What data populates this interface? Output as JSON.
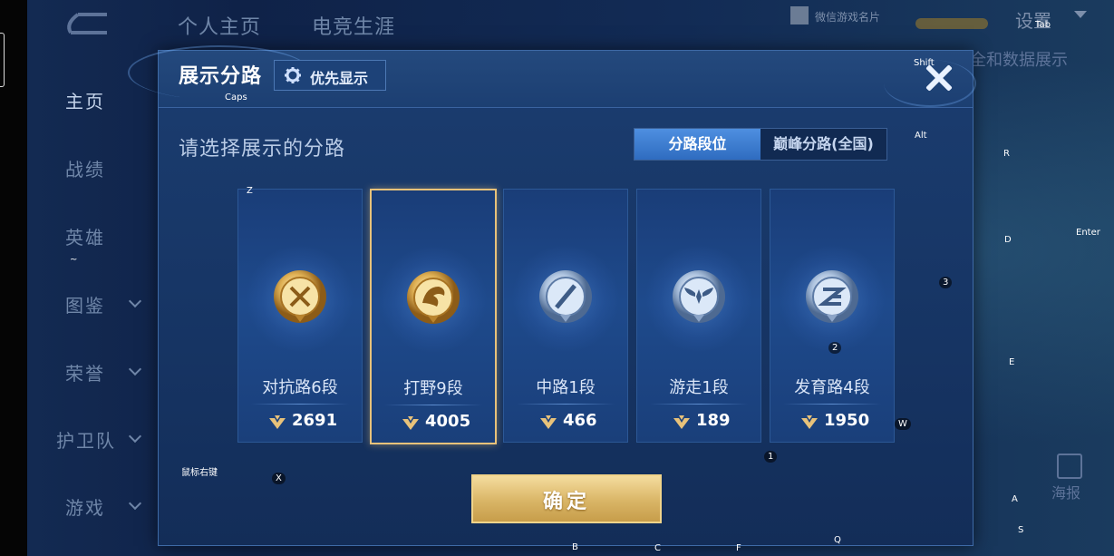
{
  "topbar": {
    "tabs": [
      "个人主页",
      "电竞生涯"
    ],
    "wechat_card": "微信游戏名片",
    "settings": "设置"
  },
  "sidebar": {
    "items": [
      {
        "label": "主页",
        "active": true,
        "has_caret": false
      },
      {
        "label": "战绩",
        "active": false,
        "has_caret": false
      },
      {
        "label": "英雄",
        "active": false,
        "has_caret": false
      },
      {
        "label": "图鉴",
        "active": false,
        "has_caret": true
      },
      {
        "label": "荣誉",
        "active": false,
        "has_caret": true
      },
      {
        "label": "护卫队",
        "active": false,
        "has_caret": true
      },
      {
        "label": "游戏",
        "active": false,
        "has_caret": true
      }
    ]
  },
  "right_peek": "全和数据展示",
  "poster_label": "海报",
  "dialog": {
    "title": "展示分路",
    "priority_button": "优先显示",
    "prompt": "请选择展示的分路",
    "segment_options": [
      "分路段位",
      "巅峰分路(全国)"
    ],
    "lanes": [
      {
        "name": "对抗路6段",
        "score": "2691",
        "badge": "sword-badge-icon",
        "tier": "gold",
        "selected": false
      },
      {
        "name": "打野9段",
        "score": "4005",
        "badge": "dragon-badge-icon",
        "tier": "gold",
        "selected": true
      },
      {
        "name": "中路1段",
        "score": "466",
        "badge": "slash-badge-icon",
        "tier": "silver",
        "selected": false
      },
      {
        "name": "游走1段",
        "score": "189",
        "badge": "wings-badge-icon",
        "tier": "silver",
        "selected": false
      },
      {
        "name": "发育路4段",
        "score": "1950",
        "badge": "arrow-badge-icon",
        "tier": "silver",
        "selected": false
      }
    ],
    "confirm_button": "确定"
  },
  "key_hints": {
    "tab": "Tab",
    "shift": "Shift",
    "caps": "Caps",
    "alt": "Alt",
    "r": "R",
    "enter": "Enter",
    "d": "D",
    "three": "3",
    "z": "Z",
    "tilde": "~",
    "two": "2",
    "e": "E",
    "w": "W",
    "one": "1",
    "rmb": "鼠标右键",
    "x": "X",
    "a": "A",
    "s": "S",
    "b": "B",
    "c": "C",
    "f": "F",
    "q": "Q"
  },
  "colors": {
    "accent_gold": "#e8c27a",
    "panel_blue": "#1b3d70",
    "selected_tab": "#3a7bd5"
  }
}
